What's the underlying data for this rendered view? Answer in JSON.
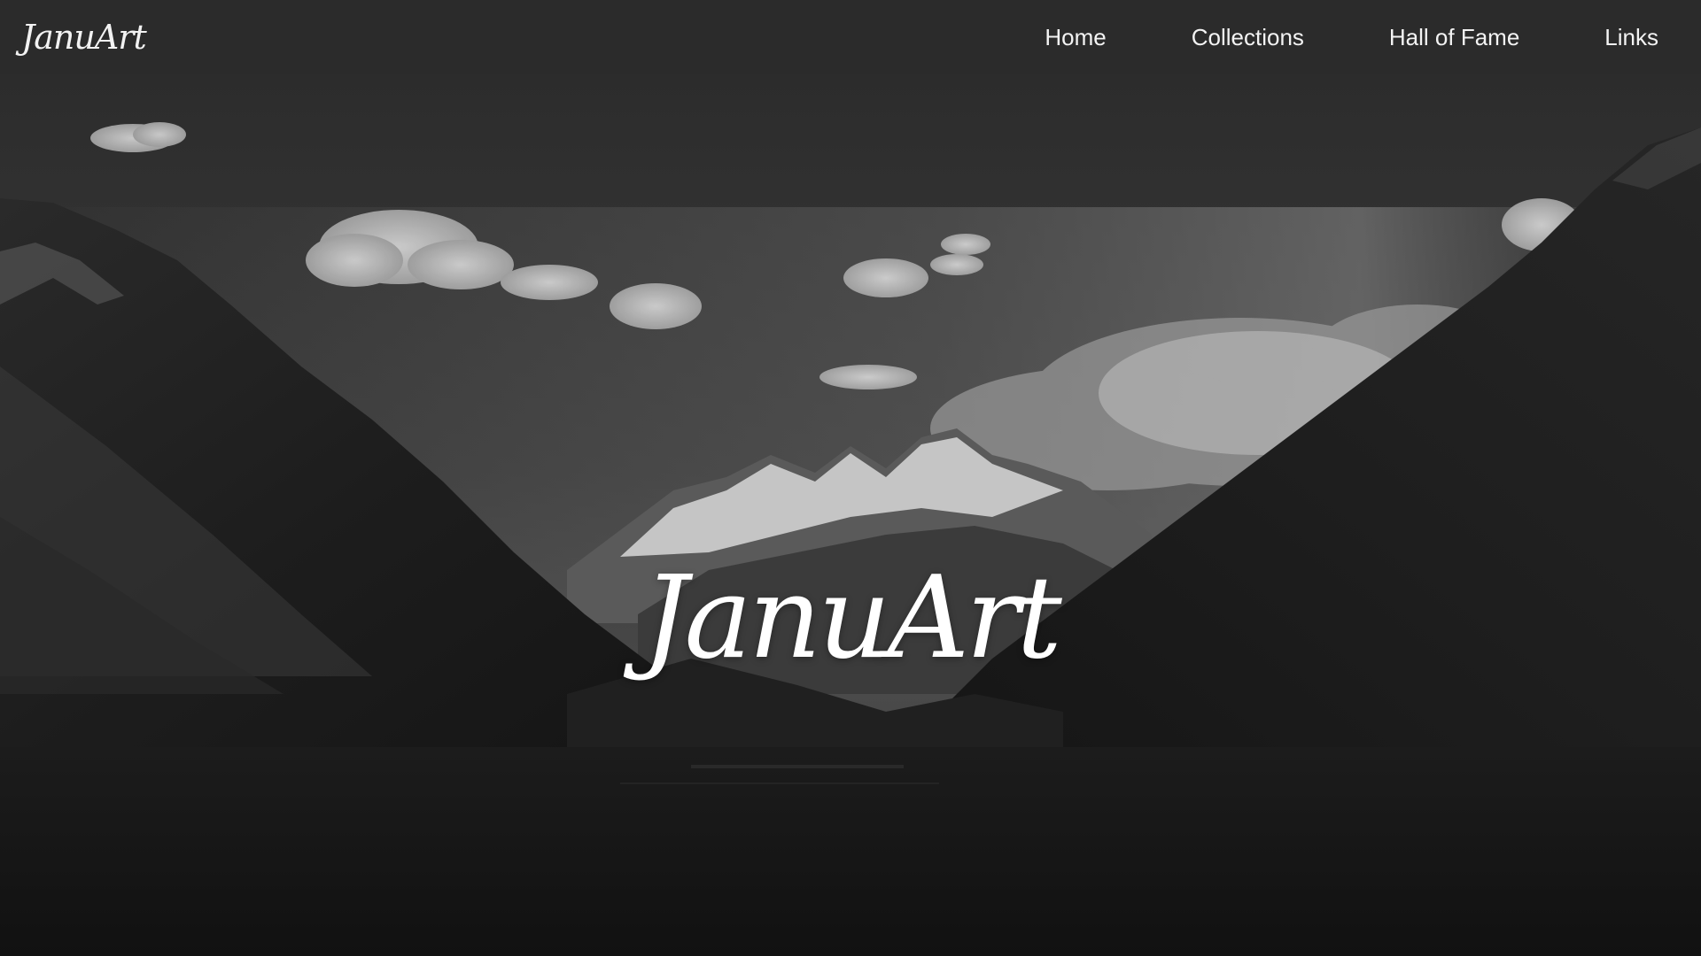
{
  "brand": {
    "logo_text": "JanuArt"
  },
  "nav": {
    "items": [
      {
        "label": "Home"
      },
      {
        "label": "Collections"
      },
      {
        "label": "Hall of Fame"
      },
      {
        "label": "Links"
      }
    ]
  },
  "hero": {
    "title": "JanuArt",
    "background": "black-and-white mountain valley with lake"
  },
  "colors": {
    "navbar_bg": "#2b2b2b",
    "nav_text": "#f3f3f3",
    "hero_text": "#ffffff"
  }
}
